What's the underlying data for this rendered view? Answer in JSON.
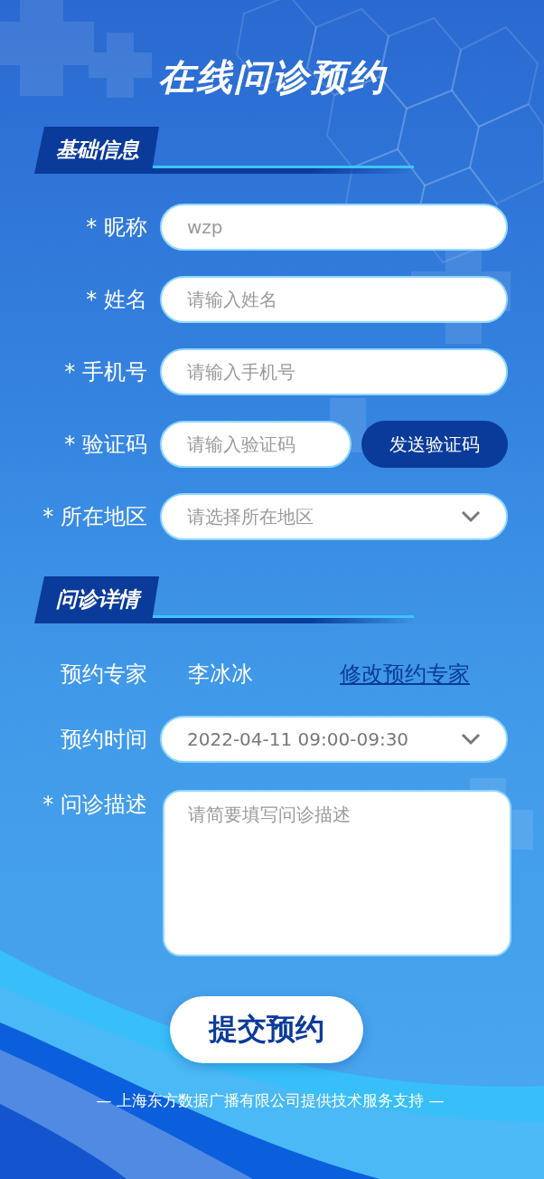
{
  "title": "在线问诊预约",
  "sections": [
    {
      "heading": "基础信息",
      "fields": [
        {
          "kind": "input",
          "label": "* 昵称",
          "value": "wzp"
        },
        {
          "kind": "input",
          "label": "* 姓名",
          "placeholder": "请输入姓名"
        },
        {
          "kind": "input",
          "label": "* 手机号",
          "placeholder": "请输入手机号"
        },
        {
          "kind": "code",
          "label": "* 验证码",
          "placeholder": "请输入验证码",
          "button": "发送验证码"
        },
        {
          "kind": "select",
          "label": "* 所在地区",
          "placeholder": "请选择所在地区"
        }
      ]
    },
    {
      "heading": "问诊详情",
      "fields": [
        {
          "kind": "text",
          "label": "预约专家",
          "value": "李冰冰",
          "link": "修改预约专家"
        },
        {
          "kind": "select",
          "label": "预约时间",
          "value": "2022-04-11 09:00-09:30"
        },
        {
          "kind": "textarea",
          "label": "* 问诊描述",
          "placeholder": "请简要填写问诊描述"
        }
      ]
    }
  ],
  "submit": "提交预约",
  "footer": "— 上海东方数据广播有限公司提供技术服务支持 —"
}
